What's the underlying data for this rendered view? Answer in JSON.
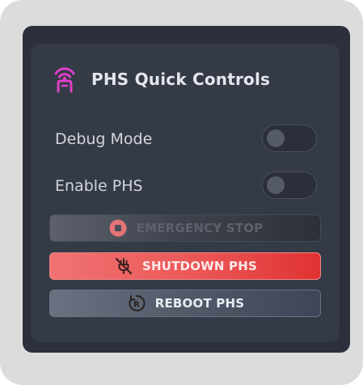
{
  "header": {
    "title": "PHS Quick Controls",
    "icon": "wireless-antenna-icon",
    "accent": "#e040c8"
  },
  "toggles": [
    {
      "label": "Debug Mode",
      "on": false
    },
    {
      "label": "Enable PHS",
      "on": false
    }
  ],
  "buttons": {
    "emergency_stop": {
      "label": "EMERGENCY STOP",
      "icon": "stop-circle-icon",
      "enabled": false,
      "icon_color": "#ff7a7a"
    },
    "shutdown": {
      "label": "SHUTDOWN PHS",
      "icon": "power-off-icon",
      "color": "#e84545"
    },
    "reboot": {
      "label": "REBOOT PHS",
      "icon": "restart-icon"
    }
  }
}
